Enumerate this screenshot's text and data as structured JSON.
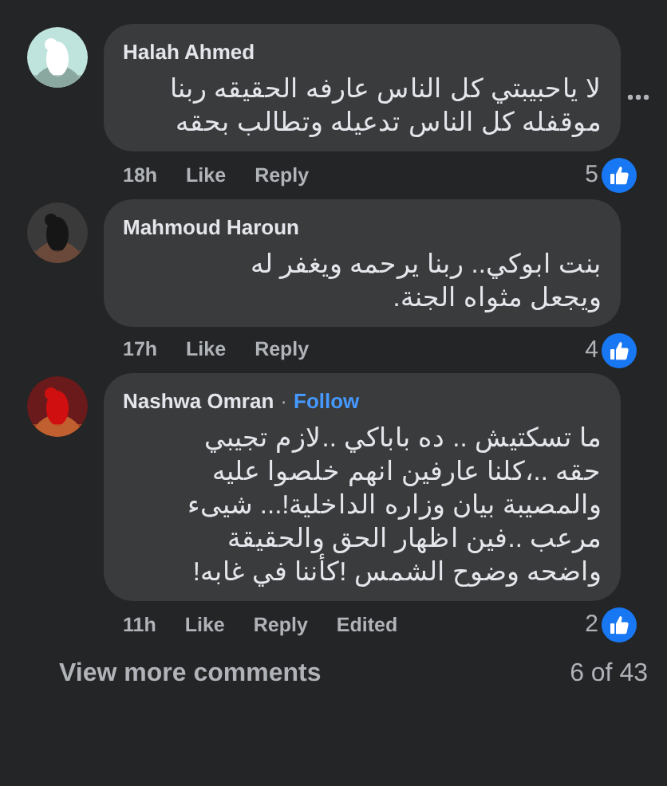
{
  "comments": [
    {
      "author": "Halah Ahmed",
      "lines": [
        "لا ياحبيبتي كل الناس عارفه الحقيقه ربنا",
        "موقفله كل الناس تدعيله وتطالب بحقه"
      ],
      "time": "18h",
      "like": "Like",
      "reply": "Reply",
      "reactions": "5",
      "menu": true,
      "avatar": {
        "kind": "picture"
      }
    },
    {
      "author": "Mahmoud Haroun",
      "lines": [
        "بنت ابوكي.. ربنا يرحمه ويغفر له",
        "ويجعل مثواه الجنة."
      ],
      "time": "17h",
      "like": "Like",
      "reply": "Reply",
      "reactions": "4",
      "menu": false,
      "avatar": {
        "kind": "picture"
      }
    },
    {
      "author": "Nashwa Omran",
      "separator": "·",
      "follow": "Follow",
      "lines": [
        "ما تسكتيش .. ده باباكي ..لازم تجيبي",
        "حقه ..،كلنا عارفين انهم خلصوا عليه",
        "والمصيبة بيان وزاره الداخلية!... شيىء",
        "مرعب ..فين اظهار الحق والحقيقة",
        "واضحه وضوح الشمس !كأننا في غابه!"
      ],
      "time": "11h",
      "like": "Like",
      "reply": "Reply",
      "edited": "Edited",
      "reactions": "2",
      "menu": false,
      "avatar": {
        "kind": "picture"
      }
    }
  ],
  "footer": {
    "link": "View more comments",
    "count": "6 of 43"
  }
}
